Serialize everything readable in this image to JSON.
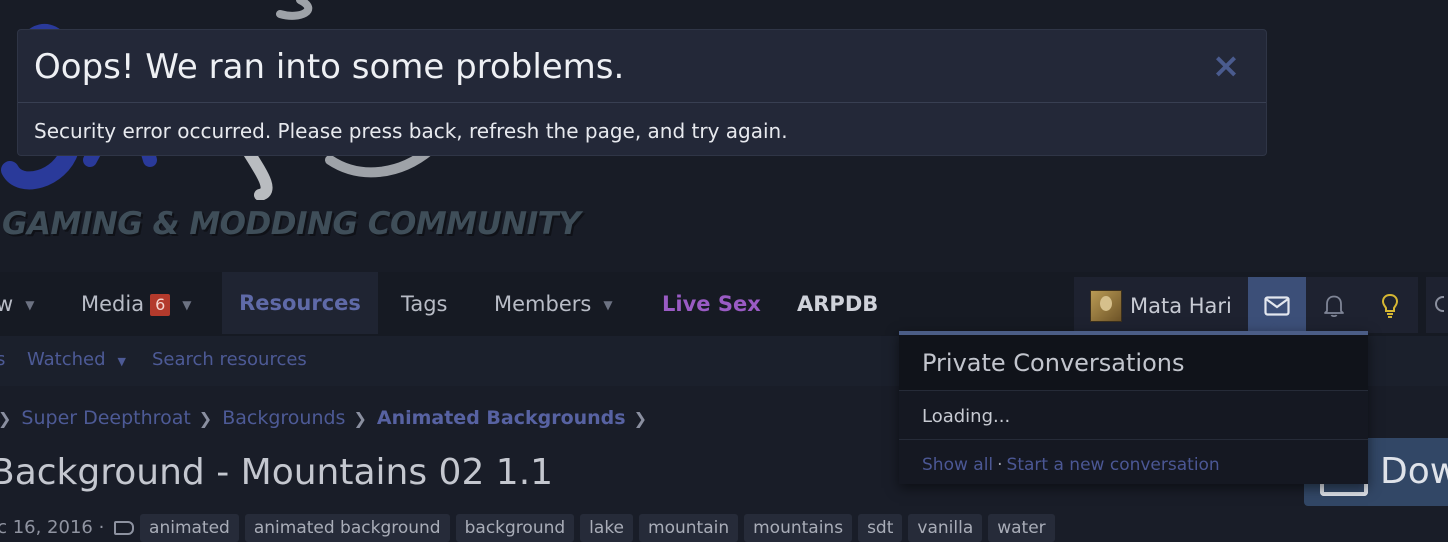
{
  "header": {
    "tagline": "GAMING & MODDING COMMUNITY"
  },
  "nav": {
    "items": [
      {
        "label": "w",
        "has_caret": true
      },
      {
        "label": "Media",
        "badge": "6",
        "has_caret": true
      },
      {
        "label": "Resources",
        "active": true
      },
      {
        "label": "Tags"
      },
      {
        "label": "Members",
        "has_caret": true
      },
      {
        "label": "Live Sex"
      },
      {
        "label": "ARPDB"
      }
    ],
    "user_name": "Mata Hari"
  },
  "subnav": {
    "items": [
      {
        "label": "s"
      },
      {
        "label": "Watched",
        "has_caret": true
      },
      {
        "label": "Search resources"
      }
    ]
  },
  "breadcrumb": {
    "items": [
      "Super Deepthroat",
      "Backgrounds",
      "Animated Backgrounds"
    ]
  },
  "page": {
    "title": "Background - Mountains 02 1.1",
    "date": "ec 16, 2016 ·",
    "tags": [
      "animated",
      "animated background",
      "background",
      "lake",
      "mountain",
      "mountains",
      "sdt",
      "vanilla",
      "water"
    ],
    "download_label": "Dow"
  },
  "error": {
    "title": "Oops! We ran into some problems.",
    "close_icon": "×",
    "message": "Security error occurred. Please press back, refresh the page, and try again."
  },
  "conversations": {
    "title": "Private Conversations",
    "loading": "Loading...",
    "show_all": "Show all",
    "separator": "·",
    "start_new": "Start a new conversation"
  },
  "icons": {
    "messages": "envelope-icon",
    "alerts": "bell-icon",
    "whats_new": "lightbulb-icon",
    "tag": "tag-icon",
    "download": "download-icon"
  },
  "colors": {
    "accent_link": "#4d5a96",
    "live": "#9a5bc4",
    "badge": "#b33a2c",
    "bulb": "#d6b733",
    "msg_active": "#3c4f78"
  }
}
